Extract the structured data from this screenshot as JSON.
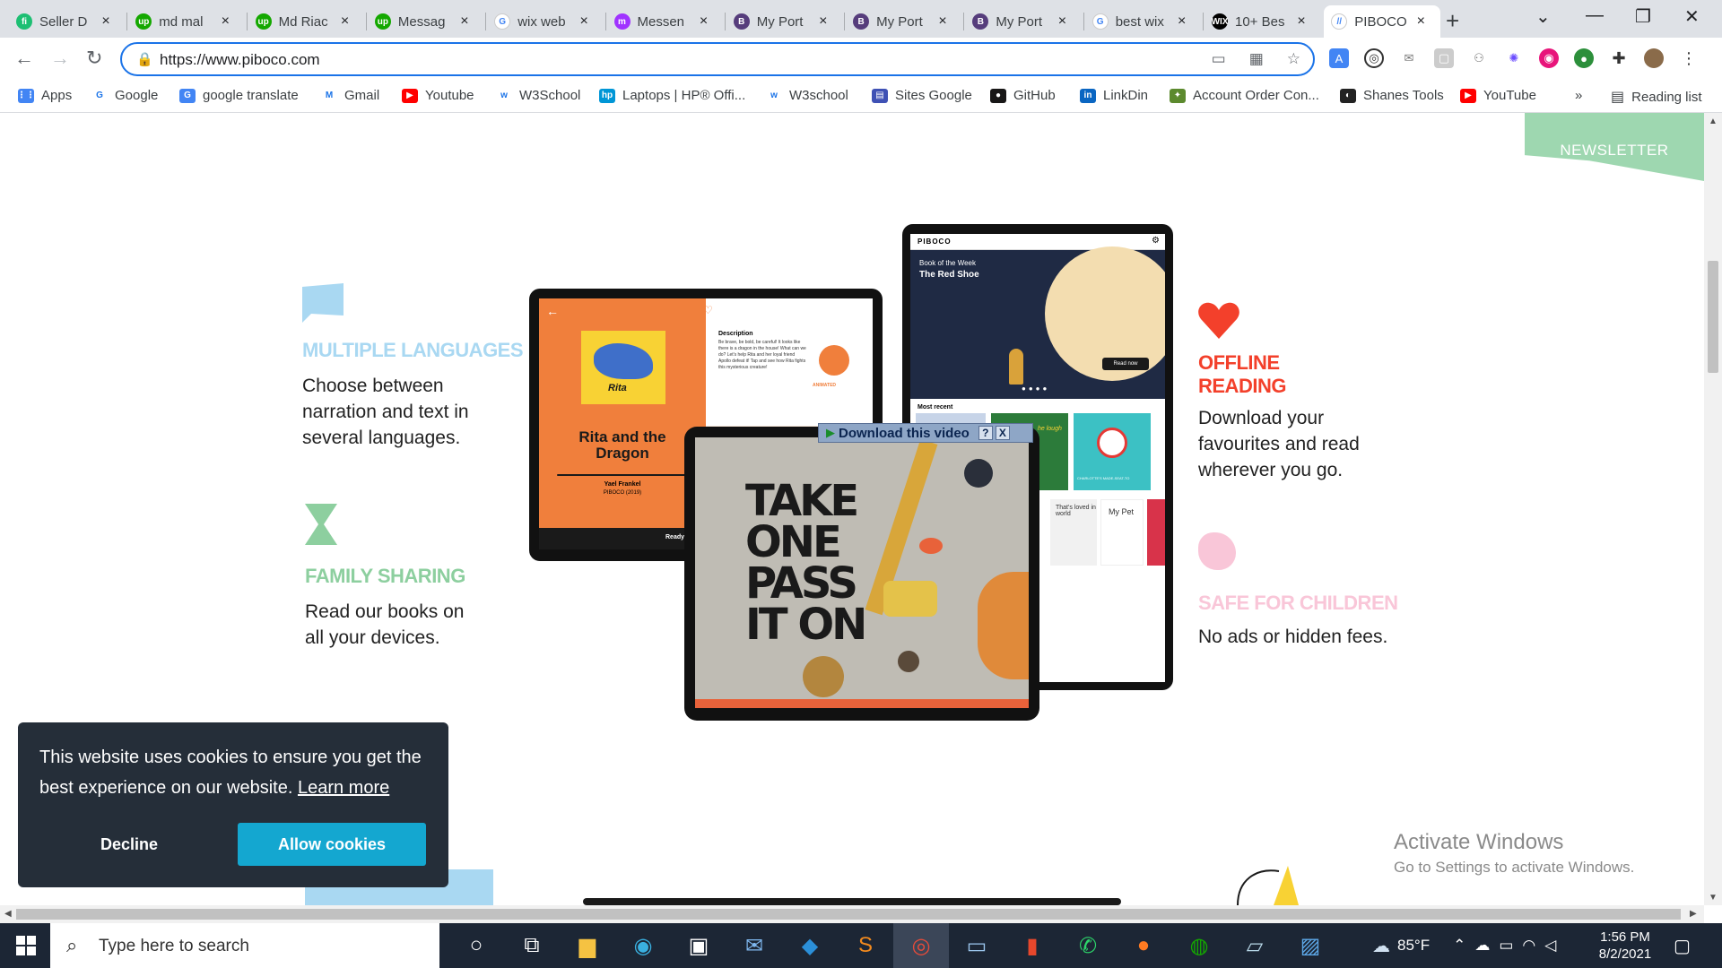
{
  "tabs": [
    {
      "title": "Seller D",
      "icon": "fiverr",
      "color": "#1dbf73",
      "glyph": "fi"
    },
    {
      "title": "md mal",
      "icon": "upwork",
      "color": "#14a800",
      "glyph": "up"
    },
    {
      "title": "Md Riac",
      "icon": "upwork",
      "color": "#14a800",
      "glyph": "up"
    },
    {
      "title": "Messag",
      "icon": "upwork",
      "color": "#14a800",
      "glyph": "up"
    },
    {
      "title": "wix web",
      "icon": "google",
      "color": "#ffffff",
      "glyph": "G"
    },
    {
      "title": "Messen",
      "icon": "messenger",
      "color": "#a033ff",
      "glyph": "m"
    },
    {
      "title": "My Port",
      "icon": "bootstrap",
      "color": "#563d7c",
      "glyph": "B"
    },
    {
      "title": "My Port",
      "icon": "bootstrap",
      "color": "#563d7c",
      "glyph": "B"
    },
    {
      "title": "My Port",
      "icon": "bootstrap",
      "color": "#563d7c",
      "glyph": "B"
    },
    {
      "title": "best wix",
      "icon": "google",
      "color": "#ffffff",
      "glyph": "G"
    },
    {
      "title": "10+ Bes",
      "icon": "wix",
      "color": "#000000",
      "glyph": "WIX"
    },
    {
      "title": "PIBOCO",
      "icon": "piboco",
      "color": "#ffffff",
      "glyph": "//"
    }
  ],
  "address_bar": {
    "url": "https://www.piboco.com"
  },
  "bookmarks": [
    {
      "label": "Apps",
      "icon": "apps-grid",
      "color": "#4285f4",
      "glyph": "⋮⋮"
    },
    {
      "label": "Google",
      "icon": "google",
      "color": "#ffffff",
      "glyph": "G"
    },
    {
      "label": "google translate",
      "icon": "translate",
      "color": "#4285f4",
      "glyph": "G"
    },
    {
      "label": "Gmail",
      "icon": "gmail",
      "color": "#ffffff",
      "glyph": "M"
    },
    {
      "label": "Youtube",
      "icon": "youtube",
      "color": "#ff0000",
      "glyph": "▶"
    },
    {
      "label": "W3School",
      "icon": "w3schools",
      "color": "#ffffff",
      "glyph": "w"
    },
    {
      "label": "Laptops | HP® Offi...",
      "icon": "hp",
      "color": "#0096d6",
      "glyph": "hp"
    },
    {
      "label": "W3school",
      "icon": "w3schools",
      "color": "#ffffff",
      "glyph": "w"
    },
    {
      "label": "Sites Google",
      "icon": "sites",
      "color": "#3f51b5",
      "glyph": "▤"
    },
    {
      "label": "GitHub",
      "icon": "github",
      "color": "#181717",
      "glyph": "●"
    },
    {
      "label": "LinkDin",
      "icon": "linkedin",
      "color": "#0a66c2",
      "glyph": "in"
    },
    {
      "label": "Account Order Con...",
      "icon": "account",
      "color": "#5c8a2e",
      "glyph": "✦"
    },
    {
      "label": "Shanes Tools",
      "icon": "tools",
      "color": "#222222",
      "glyph": "◐"
    },
    {
      "label": "YouTube",
      "icon": "youtube",
      "color": "#ff0000",
      "glyph": "▶"
    }
  ],
  "bookmarks_more": "»",
  "reading_list": "Reading list",
  "page": {
    "newsletter": "NEWSLETTER",
    "features": [
      {
        "title": "MULTIPLE LANGUAGES",
        "desc": [
          "Choose between",
          "narration and text in",
          "several languages."
        ],
        "color": "#a9d8f2"
      },
      {
        "title": "FAMILY SHARING",
        "desc": [
          "Read our books on",
          "all your devices."
        ],
        "color": "#8dcf9f"
      },
      {
        "title": "OFFLINE",
        "title2": "READING",
        "desc": [
          "Download your",
          "favourites and read",
          "wherever you go."
        ],
        "color": "#f3402b"
      },
      {
        "title": "SAFE FOR CHILDREN",
        "desc": [
          "No ads or hidden fees."
        ],
        "color": "#f9c6d8"
      }
    ],
    "tablet_left": {
      "book_title_1": "Rita and the",
      "book_title_2": "Dragon",
      "author": "Yael Frankel",
      "publisher": "PIBOCO (2019)",
      "description_label": "Description",
      "description": "Be brave, be bold, be careful! It looks like there is a dragon in the house! What can we do? Let's help Rita and her loyal friend Apollo defeat it! Tap and see how Rita fights this mysterious creature!",
      "animated": "ANIMATED",
      "ready": "Ready?",
      "cover_label": "Rita"
    },
    "tablet_right": {
      "brand": "PIBOCO",
      "book_of_week": "Book of the Week",
      "book_name": "The Red Shoe",
      "read_now": "Read now",
      "most_recent": "Most recent",
      "thumb_text_1": "he lough",
      "thumb_text_2": "CHARLOTTE'S MADE-SEAT-TO",
      "thumb_text_3": "That's loved in world",
      "thumb_text_4": "My Pet"
    },
    "tablet_front": {
      "art_text": [
        "TAKE",
        "ONE",
        "PASS",
        "IT ON"
      ]
    },
    "download_bar": {
      "label": "Download this video",
      "help": "?",
      "close": "X"
    },
    "activate_windows": {
      "title": "Activate Windows",
      "subtitle": "Go to Settings to activate Windows."
    },
    "cookie_banner": {
      "message": "This website uses cookies to ensure you get the best experience on our website.",
      "learn_more": "Learn more",
      "decline": "Decline",
      "allow": "Allow cookies"
    }
  },
  "taskbar": {
    "search_placeholder": "Type here to search",
    "weather": "85°F",
    "time": "1:56 PM",
    "date": "8/2/2021"
  }
}
